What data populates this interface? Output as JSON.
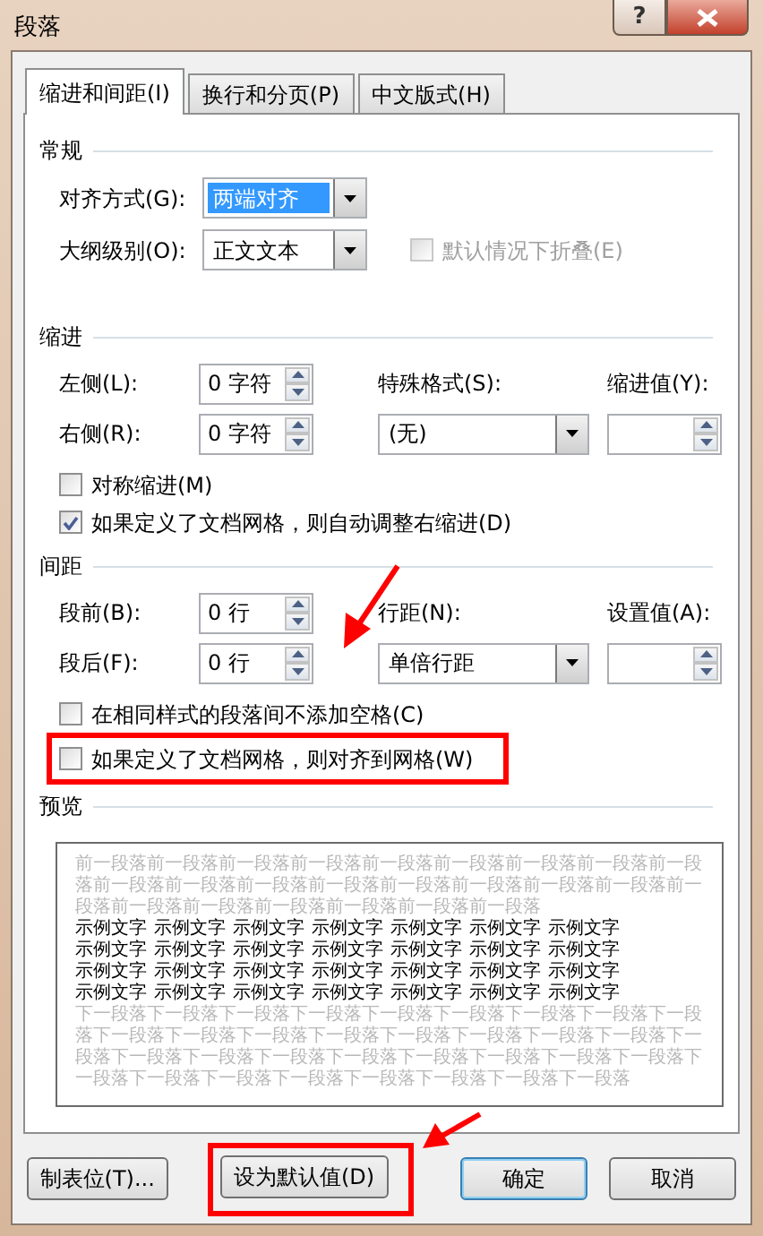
{
  "window": {
    "title": "段落",
    "help_glyph": "?"
  },
  "tabs": [
    {
      "label": "缩进和间距(I)",
      "selected": true
    },
    {
      "label": "换行和分页(P)",
      "selected": false
    },
    {
      "label": "中文版式(H)",
      "selected": false
    }
  ],
  "general": {
    "title": "常规",
    "alignment": {
      "label": "对齐方式(G):",
      "value": "两端对齐",
      "highlighted": true
    },
    "outline": {
      "label": "大纲级别(O):",
      "value": "正文文本",
      "highlighted": false
    },
    "collapse": {
      "label": "默认情况下折叠(E)",
      "checked": false,
      "disabled": true
    }
  },
  "indent": {
    "title": "缩进",
    "left": {
      "label": "左侧(L):",
      "value": "0 字符"
    },
    "right": {
      "label": "右侧(R):",
      "value": "0 字符"
    },
    "special": {
      "label": "特殊格式(S):",
      "value": "(无)"
    },
    "by": {
      "label": "缩进值(Y):"
    },
    "checkboxes": [
      {
        "label": "对称缩进(M)",
        "checked": false
      },
      {
        "label": "如果定义了文档网格，则自动调整右缩进(D)",
        "checked": true
      }
    ]
  },
  "spacing": {
    "title": "间距",
    "before": {
      "label": "段前(B):",
      "value": "0 行"
    },
    "after": {
      "label": "段后(F):",
      "value": "0 行"
    },
    "line": {
      "label": "行距(N):",
      "value": "单倍行距"
    },
    "at": {
      "label": "设置值(A):"
    },
    "checkboxes": [
      {
        "label": "在相同样式的段落间不添加空格(C)",
        "checked": false,
        "annotated": false
      },
      {
        "label": "如果定义了文档网格，则对齐到网格(W)",
        "checked": false,
        "annotated": true
      }
    ]
  },
  "preview": {
    "title": "预览",
    "before_text": "前一段落前一段落前一段落前一段落前一段落前一段落前一段落前一段落前一段落前一段落前一段落前一段落前一段落前一段落前一段落前一段落前一段落前一段落前一段落前一段落前一段落前一段落前一段落前一段落",
    "sample_words": [
      "示例文字",
      "示例文字",
      "示例文字",
      "示例文字",
      "示例文字",
      "示例文字",
      "示例文字",
      "示例文字",
      "示例文字",
      "示例文字",
      "示例文字",
      "示例文字",
      "示例文字",
      "示例文字",
      "示例文字",
      "示例文字",
      "示例文字",
      "示例文字",
      "示例文字",
      "示例文字",
      "示例文字",
      "示例文字",
      "示例文字",
      "示例文字",
      "示例文字",
      "示例文字",
      "示例文字",
      "示例文字"
    ],
    "after_text": "下一段落下一段落下一段落下一段落下一段落下一段落下一段落下一段落下一段落下一段落下一段落下一段落下一段落下一段落下一段落下一段落下一段落下一段落下一段落下一段落下一段落下一段落下一段落下一段落下一段落下一段落下一段落下一段落下一段落下一段落下一段落下一段落下一段落下一段落"
  },
  "buttons": [
    {
      "label": "制表位(T)...",
      "focused": false,
      "annotated": false
    },
    {
      "label": "设为默认值(D)",
      "focused": false,
      "annotated": true
    },
    {
      "label": "确定",
      "focused": true,
      "annotated": false
    },
    {
      "label": "取消",
      "focused": false,
      "annotated": false
    }
  ]
}
